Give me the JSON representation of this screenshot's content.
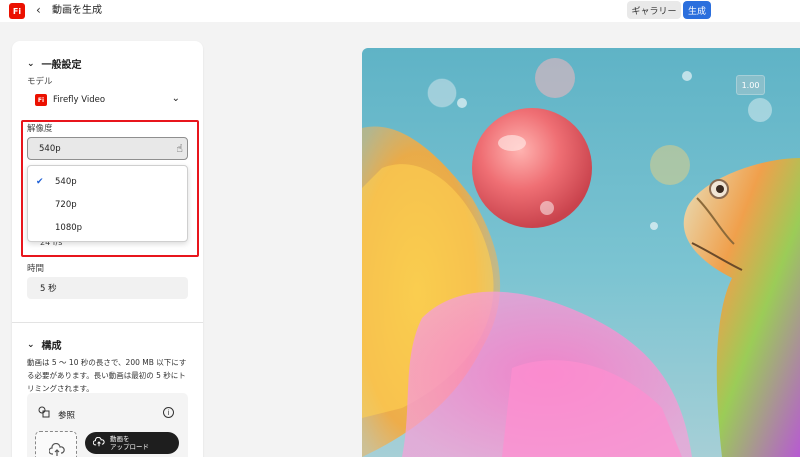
{
  "header": {
    "logo_text": "Fi",
    "back_glyph": "‹",
    "title": "動画を生成",
    "gallery_label": "ギャラリー",
    "generate_label": "生成"
  },
  "general": {
    "title": "一般設定",
    "model_label": "モデル",
    "model_logo_text": "Fi",
    "model_value": "Firefly Video",
    "resolution_label": "解像度",
    "resolution_value": "540p",
    "resolution_options": [
      {
        "label": "540p",
        "selected": true
      },
      {
        "label": "720p",
        "selected": false
      },
      {
        "label": "1080p",
        "selected": false
      }
    ],
    "fps_partial": "24 f/s",
    "duration_label": "時間",
    "duration_value": "5 秒"
  },
  "composition": {
    "title": "構成",
    "description": "動画は 5 〜 10 秒の長さで、200 MB 以下にする必要があります。長い動画は最初の 5 秒にトリミングされます。",
    "reference_label": "参照",
    "upload_label_line1": "動画を",
    "upload_label_line2": "アップロード"
  },
  "preview": {
    "zoom": "1.00"
  },
  "colors": {
    "brand_red": "#eb1000",
    "accent_blue": "#2b6fdd",
    "highlight_red": "#e8151c"
  },
  "icons": [
    "firefly-logo-icon",
    "back-arrow-icon",
    "chevron-down-icon",
    "checkmark-icon",
    "hand-cursor-icon",
    "reference-shapes-icon",
    "info-icon",
    "cloud-upload-icon"
  ]
}
